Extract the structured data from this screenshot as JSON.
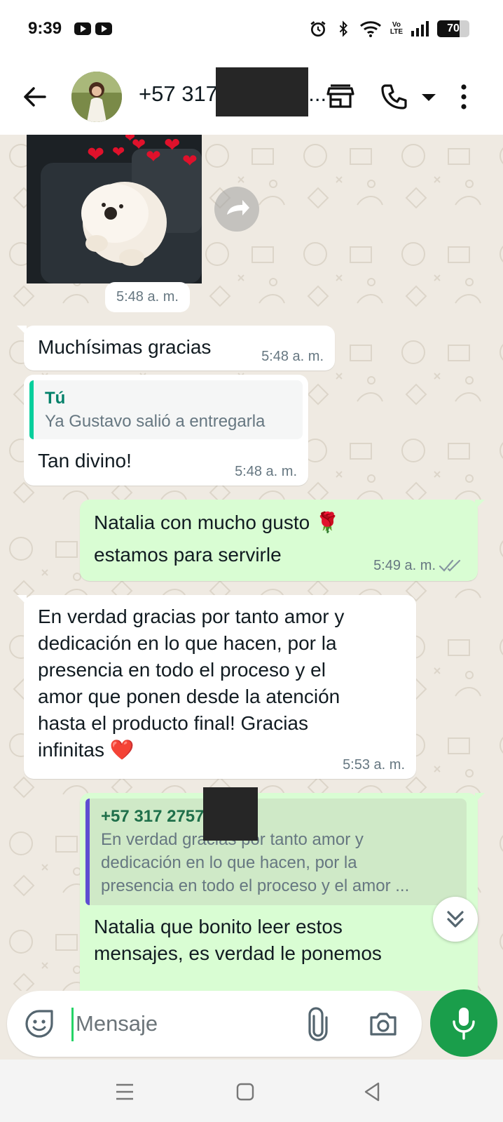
{
  "status_bar": {
    "time": "9:39",
    "volte_line1": "Vo",
    "volte_line2": "LTE",
    "battery": "70",
    "battery_level": 0.7,
    "icons": [
      "youtube-icon",
      "youtube-icon",
      "alarm-icon",
      "bluetooth-icon",
      "wifi-icon",
      "volte-icon",
      "signal-icon",
      "battery-icon"
    ]
  },
  "header": {
    "contact_name": "+57 317 2757323...",
    "icons": [
      "back-arrow-icon",
      "avatar",
      "store-icon",
      "phone-icon",
      "chevron-down-icon",
      "more-vert-icon"
    ]
  },
  "chat": {
    "image_message": {
      "time": "5:48 a. m.",
      "forward_icon": "forward-icon"
    },
    "messages": [
      {
        "type": "in",
        "text": "Muchísimas gracias",
        "time": "5:48 a. m."
      },
      {
        "type": "in",
        "quote_author": "Tú",
        "quote_text": "Ya Gustavo salió a entregarla",
        "text": "Tan divino!",
        "time": "5:48 a. m."
      },
      {
        "type": "out",
        "line1": "Natalia con mucho gusto 🌹",
        "line2": "estamos para servirle",
        "time": "5:49 a. m.",
        "status_icon": "double-check-icon"
      },
      {
        "type": "in",
        "lines": [
          "En verdad gracias por tanto amor y",
          "dedicación en lo que hacen, por la",
          "presencia en todo el proceso y el",
          "amor que ponen desde la atención",
          "hasta el producto final! Gracias",
          "infinitas ❤️"
        ],
        "time": "5:53 a. m."
      },
      {
        "type": "out",
        "quote_author": "+57 317 2757323",
        "quote_lines": [
          "En verdad gracias por tanto amor y",
          "dedicación en lo que hacen, por la",
          "presencia en todo el proceso y el amor ..."
        ],
        "lines": [
          "Natalia que bonito leer estos",
          "mensajes, es verdad le ponemos"
        ]
      }
    ]
  },
  "composer": {
    "placeholder": "Mensaje",
    "icons": [
      "sticker-emoji-icon",
      "attach-icon",
      "camera-icon",
      "mic-icon"
    ]
  },
  "nav_bar": {
    "icons": [
      "menu-icon",
      "home-icon",
      "back-icon"
    ]
  },
  "colors": {
    "incoming_bubble": "#ffffff",
    "outgoing_bubble": "#d9fdd3",
    "chat_bg": "#efeae2",
    "quote_self": "#06cf9c",
    "quote_contact": "#5e4ed2",
    "mic_button": "#1a9e4b",
    "read_ticks": "#8696a0"
  }
}
